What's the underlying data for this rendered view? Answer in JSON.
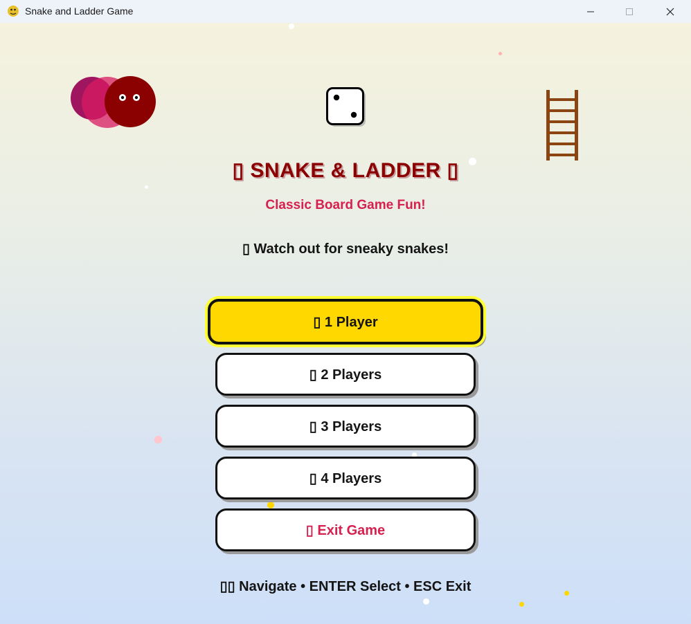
{
  "window": {
    "title": "Snake and Ladder Game",
    "icon": "python-snake-icon"
  },
  "title_bar_controls": {
    "minimize_icon": "minimize-icon",
    "maximize_icon": "maximize-icon",
    "close_icon": "close-icon"
  },
  "header": {
    "title": "▯ SNAKE & LADDER ▯",
    "subtitle": "Classic Board Game Fun!",
    "tagline": "▯ Watch out for sneaky snakes!"
  },
  "decorations": {
    "snake_icon": "snake-head-icon",
    "dice_icon": "dice-icon",
    "dice_face": 2,
    "ladder_icon": "ladder-icon"
  },
  "menu": {
    "selected_index": 0,
    "items": [
      {
        "label": "▯ 1 Player"
      },
      {
        "label": "▯ 2 Players"
      },
      {
        "label": "▯ 3 Players"
      },
      {
        "label": "▯ 4 Players"
      },
      {
        "label": "▯ Exit Game"
      }
    ]
  },
  "footer": {
    "hint": "▯▯ Navigate • ENTER Select • ESC Exit"
  },
  "colors": {
    "title": "#8b0000",
    "subtitle": "#d6204f",
    "selected_button": "#ffd800",
    "selected_glow": "#ffff33",
    "exit_text": "#d6204f",
    "ladder": "#8b4513",
    "snake_head": "#8b0000",
    "snake_body": "#c2185b"
  }
}
